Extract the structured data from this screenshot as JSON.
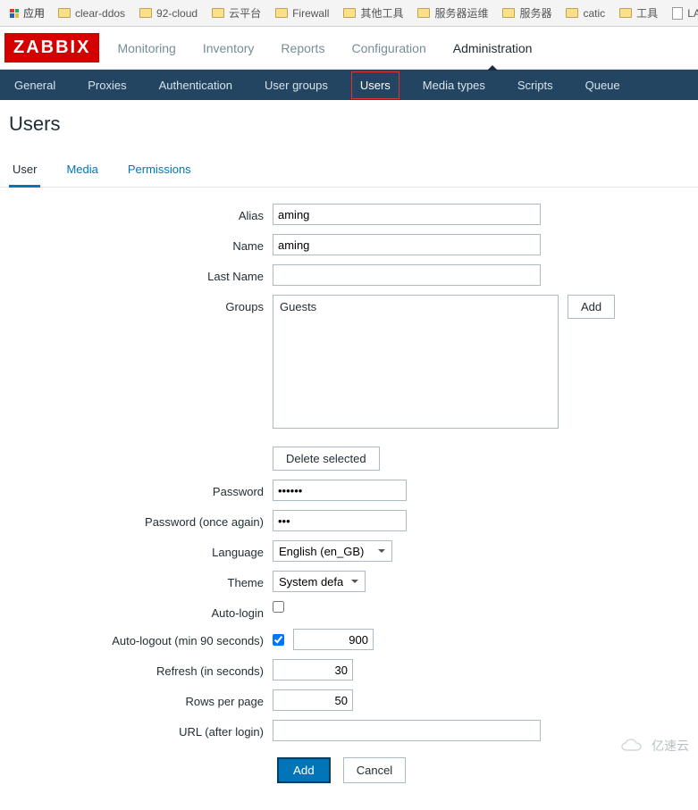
{
  "bookmarks": {
    "apps_label": "应用",
    "items": [
      "clear-ddos",
      "92-cloud",
      "云平台",
      "Firewall",
      "其他工具",
      "服务器运维",
      "服务器",
      "catic",
      "工具"
    ],
    "extra_page": "LAX"
  },
  "brand": "ZABBIX",
  "main_nav": {
    "items": [
      "Monitoring",
      "Inventory",
      "Reports",
      "Configuration",
      "Administration"
    ],
    "active_index": 4
  },
  "sub_nav": {
    "items": [
      "General",
      "Proxies",
      "Authentication",
      "User groups",
      "Users",
      "Media types",
      "Scripts",
      "Queue"
    ],
    "active_index": 4
  },
  "page_title": "Users",
  "tabs": {
    "items": [
      "User",
      "Media",
      "Permissions"
    ],
    "active_index": 0
  },
  "form": {
    "labels": {
      "alias": "Alias",
      "name": "Name",
      "last_name": "Last Name",
      "groups": "Groups",
      "password": "Password",
      "password2": "Password (once again)",
      "language": "Language",
      "theme": "Theme",
      "auto_login": "Auto-login",
      "auto_logout": "Auto-logout (min 90 seconds)",
      "refresh": "Refresh (in seconds)",
      "rows": "Rows per page",
      "url": "URL (after login)"
    },
    "values": {
      "alias": "aming",
      "name": "aming",
      "last_name": "",
      "groups": [
        "Guests"
      ],
      "password": "••••••",
      "password2": "•••",
      "language": "English (en_GB)",
      "theme": "System default",
      "auto_login": false,
      "auto_logout_enabled": true,
      "auto_logout": "900",
      "refresh": "30",
      "rows": "50",
      "url": ""
    },
    "buttons": {
      "add_group": "Add",
      "delete_selected": "Delete selected",
      "add": "Add",
      "cancel": "Cancel"
    }
  },
  "watermark": "亿速云"
}
